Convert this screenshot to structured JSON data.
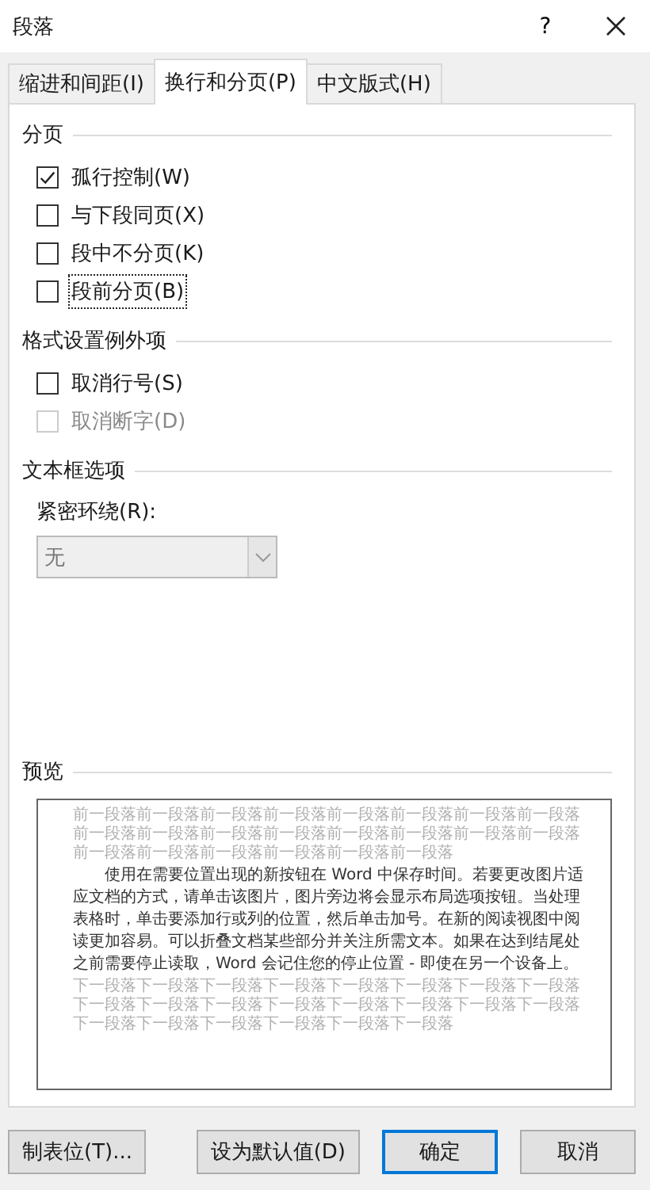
{
  "window": {
    "title": "段落",
    "help": "?"
  },
  "tabs": [
    {
      "label": "缩进和间距(I)",
      "selected": false
    },
    {
      "label": "换行和分页(P)",
      "selected": true
    },
    {
      "label": "中文版式(H)",
      "selected": false
    }
  ],
  "sections": [
    {
      "title": "分页",
      "options": [
        {
          "label": "孤行控制(W)",
          "checked": true,
          "disabled": false,
          "focused": false
        },
        {
          "label": "与下段同页(X)",
          "checked": false,
          "disabled": false,
          "focused": false
        },
        {
          "label": "段中不分页(K)",
          "checked": false,
          "disabled": false,
          "focused": false
        },
        {
          "label": "段前分页(B)",
          "checked": false,
          "disabled": false,
          "focused": true
        }
      ]
    },
    {
      "title": "格式设置例外项",
      "options": [
        {
          "label": "取消行号(S)",
          "checked": false,
          "disabled": false,
          "focused": false
        },
        {
          "label": "取消断字(D)",
          "checked": false,
          "disabled": true,
          "focused": false
        }
      ]
    }
  ],
  "text_box_options": {
    "title": "文本框选项",
    "tight_wrap": {
      "label": "紧密环绕(R):",
      "value": "无",
      "disabled": true
    }
  },
  "preview": {
    "title": "预览",
    "previous_paragraph": "前一段落前一段落前一段落前一段落前一段落前一段落前一段落前一段落前一段落前一段落前一段落前一段落前一段落前一段落前一段落前一段落前一段落前一段落前一段落前一段落前一段落前一段落",
    "sample_text": "使用在需要位置出现的新按钮在 Word 中保存时间。若要更改图片适应文档的方式，请单击该图片，图片旁边将会显示布局选项按钮。当处理表格时，单击要添加行或列的位置，然后单击加号。在新的阅读视图中阅读更加容易。可以折叠文档某些部分并关注所需文本。如果在达到结尾处之前需要停止读取，Word 会记住您的停止位置 - 即使在另一个设备上。",
    "next_paragraph": "下一段落下一段落下一段落下一段落下一段落下一段落下一段落下一段落下一段落下一段落下一段落下一段落下一段落下一段落下一段落下一段落下一段落下一段落下一段落下一段落下一段落下一段落"
  },
  "buttons": [
    {
      "label": "制表位(T)...",
      "default": false
    },
    {
      "label": "设为默认值(D)",
      "default": false
    },
    {
      "label": "确定",
      "default": true
    },
    {
      "label": "取消",
      "default": false
    }
  ]
}
